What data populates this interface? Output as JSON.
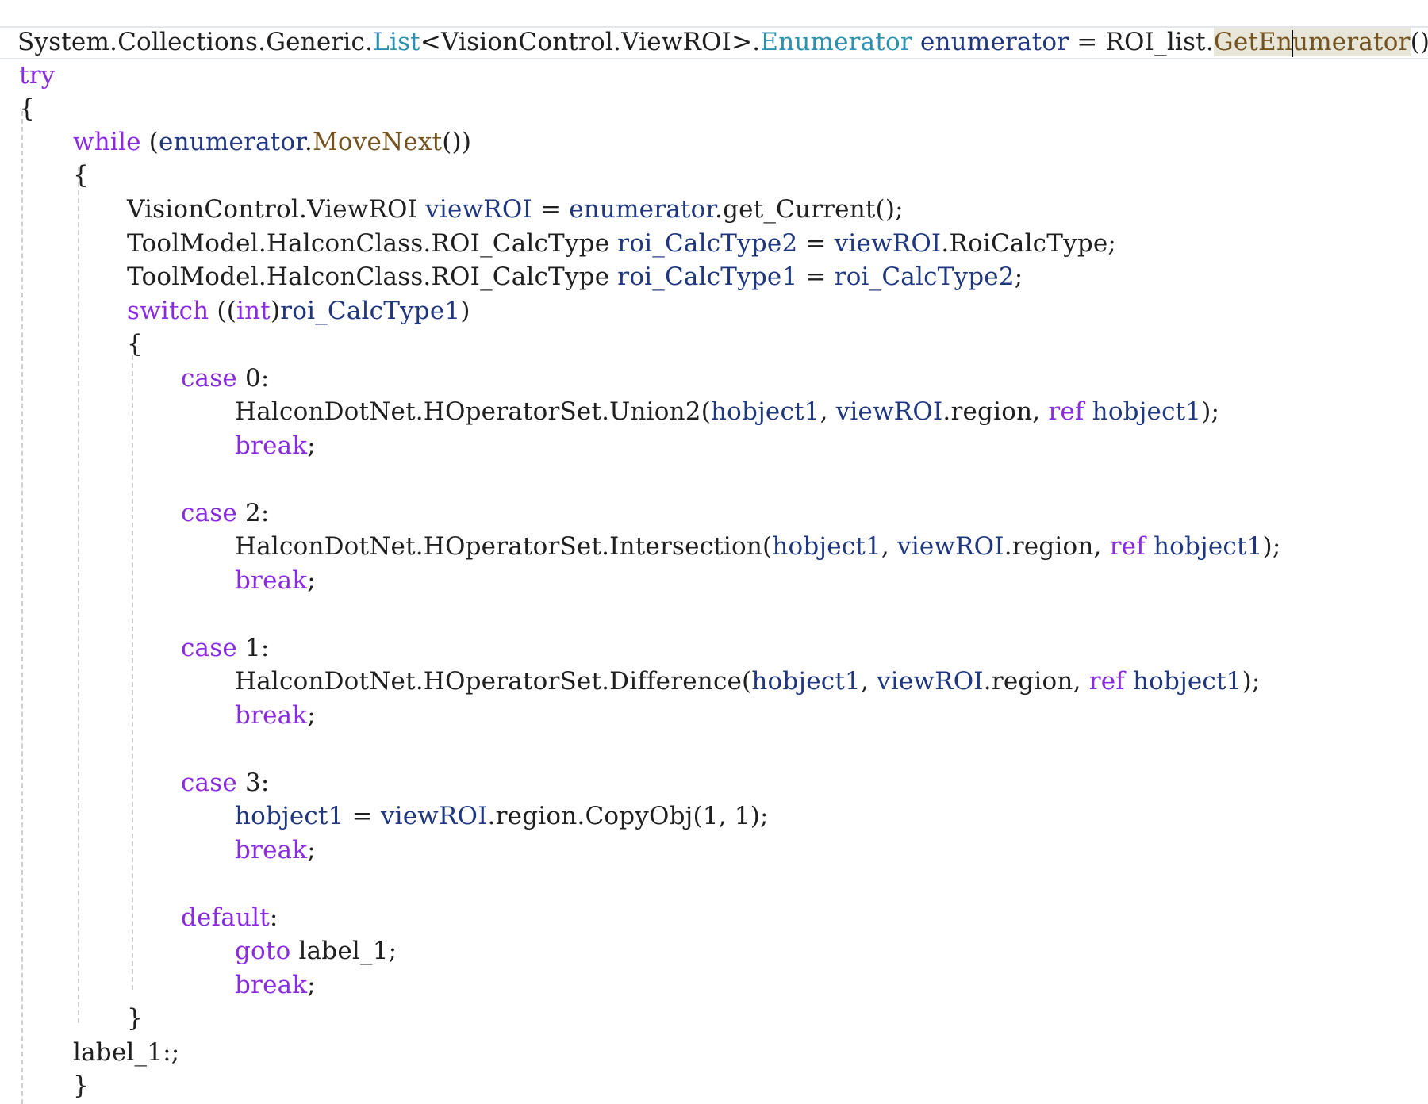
{
  "colors": {
    "keyword": "#8a2be2",
    "type": "#2b91af",
    "variable": "#1f377f",
    "method": "#74531f",
    "plain": "#1f1f1f",
    "guide": "#cfcfcf",
    "current_line_border": "#e3e6ef",
    "highlight": "#e8e6d9"
  },
  "code": {
    "line1": {
      "a": "System.Collections.Generic.",
      "b": "List",
      "c": "<VisionControl.ViewROI>.",
      "d": "Enumerator",
      "e": " ",
      "f": "enumerator",
      "g": " = ROI_list.",
      "h1": "GetEn",
      "h2": "umerator",
      "i": "();"
    },
    "line2": {
      "a": "try"
    },
    "line3": {
      "a": "{"
    },
    "line4": {
      "a": "while",
      "b": " (",
      "c": "enumerator",
      "d": ".",
      "e": "MoveNext",
      "f": "())"
    },
    "line5": {
      "a": "{"
    },
    "line6": {
      "a": "VisionControl.ViewROI ",
      "b": "viewROI",
      "c": " = ",
      "d": "enumerator",
      "e": ".get_Current();"
    },
    "line7": {
      "a": "ToolModel.HalconClass.ROI_CalcType ",
      "b": "roi_CalcType2",
      "c": " = ",
      "d": "viewROI",
      "e": ".RoiCalcType;"
    },
    "line8": {
      "a": "ToolModel.HalconClass.ROI_CalcType ",
      "b": "roi_CalcType1",
      "c": " = ",
      "d": "roi_CalcType2",
      "e": ";"
    },
    "line9": {
      "a": "switch",
      "b": " ((",
      "c": "int",
      "d": ")",
      "e": "roi_CalcType1",
      "f": ")"
    },
    "line10": {
      "a": "{"
    },
    "line11": {
      "a": "case",
      "b": " 0:"
    },
    "line12": {
      "a": "HalconDotNet.HOperatorSet.Union2(",
      "b": "hobject1",
      "c": ", ",
      "d": "viewROI",
      "e": ".region, ",
      "f": "ref",
      "g": " ",
      "h": "hobject1",
      "i": ");"
    },
    "line13": {
      "a": "break",
      "b": ";"
    },
    "line14": {
      "a": "case",
      "b": " 2:"
    },
    "line15": {
      "a": "HalconDotNet.HOperatorSet.Intersection(",
      "b": "hobject1",
      "c": ", ",
      "d": "viewROI",
      "e": ".region, ",
      "f": "ref",
      "g": " ",
      "h": "hobject1",
      "i": ");"
    },
    "line16": {
      "a": "break",
      "b": ";"
    },
    "line17": {
      "a": "case",
      "b": " 1:"
    },
    "line18": {
      "a": "HalconDotNet.HOperatorSet.Difference(",
      "b": "hobject1",
      "c": ", ",
      "d": "viewROI",
      "e": ".region, ",
      "f": "ref",
      "g": " ",
      "h": "hobject1",
      "i": ");"
    },
    "line19": {
      "a": "break",
      "b": ";"
    },
    "line20": {
      "a": "case",
      "b": " 3:"
    },
    "line21": {
      "a": "hobject1",
      "b": " = ",
      "c": "viewROI",
      "d": ".region.CopyObj(1, 1);"
    },
    "line22": {
      "a": "break",
      "b": ";"
    },
    "line23": {
      "a": "default",
      "b": ":"
    },
    "line24": {
      "a": "goto",
      "b": " label_1;"
    },
    "line25": {
      "a": "break",
      "b": ";"
    },
    "line26": {
      "a": "}"
    },
    "line27": {
      "a": "label_1:;"
    },
    "line28": {
      "a": "}"
    }
  }
}
